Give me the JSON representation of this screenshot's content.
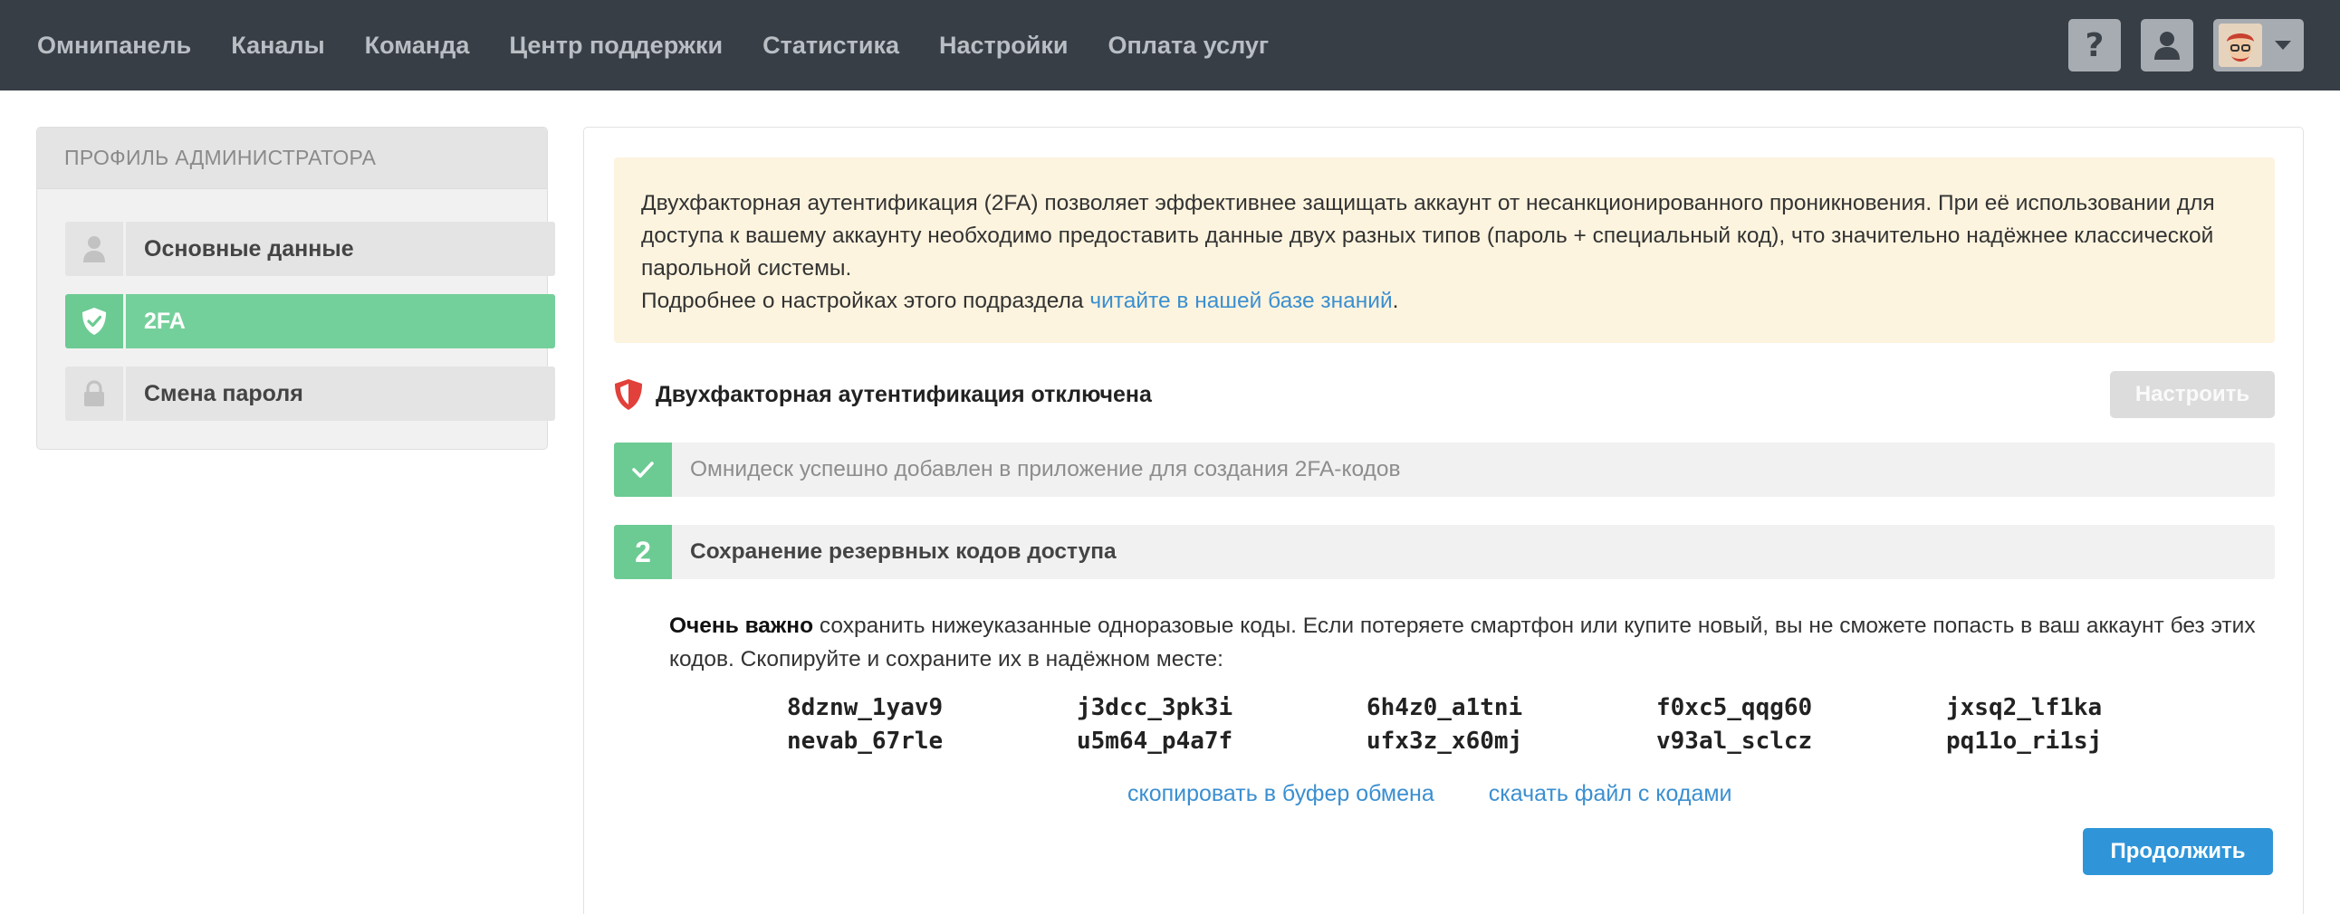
{
  "nav": {
    "items": [
      "Омнипанель",
      "Каналы",
      "Команда",
      "Центр поддержки",
      "Статистика",
      "Настройки",
      "Оплата услуг"
    ]
  },
  "topbar": {
    "help_label": "?"
  },
  "sidebar": {
    "header": "ПРОФИЛЬ АДМИНИСТРАТОРА",
    "items": [
      {
        "label": "Основные данные",
        "icon": "user-icon"
      },
      {
        "label": "2FA",
        "icon": "shield-check-icon",
        "active": true
      },
      {
        "label": "Смена пароля",
        "icon": "lock-icon"
      }
    ]
  },
  "notice": {
    "line1": "Двухфакторная аутентификация (2FA) позволяет эффективнее защищать аккаунт от несанкционированного проникновения. При её использовании для доступа к вашему аккаунту необходимо предоставить данные двух разных типов (пароль + специальный код), что значительно надёжнее классической парольной системы.",
    "line2_prefix": "Подробнее о настройках этого подраздела ",
    "link": "читайте в нашей базе знаний",
    "line2_suffix": "."
  },
  "status": {
    "text": "Двухфакторная аутентификация отключена",
    "setup_button": "Настроить"
  },
  "steps": [
    {
      "badge": "✓",
      "text": "Омнидеск успешно добавлен в приложение для создания 2FA-кодов"
    },
    {
      "badge": "2",
      "text": "Сохранение резервных кодов доступа"
    }
  ],
  "backup": {
    "bold_prefix": "Очень важно",
    "description": " сохранить нижеуказанные одноразовые коды. Если потеряете смартфон или купите новый, вы не сможете попасть в ваш аккаунт без этих кодов. Скопируйте и сохраните их в надёжном месте:",
    "codes": [
      "8dznw_1yav9",
      "j3dcc_3pk3i",
      "6h4z0_a1tni",
      "f0xc5_qqg60",
      "jxsq2_lf1ka",
      "nevab_67rle",
      "u5m64_p4a7f",
      "ufx3z_x60mj",
      "v93al_sclcz",
      "pq11o_ri1sj"
    ],
    "copy_link": "скопировать в буфер обмена",
    "download_link": "скачать файл с кодами",
    "continue_button": "Продолжить"
  },
  "colors": {
    "topbar": "#383e45",
    "accent_green": "#74d09a",
    "link_blue": "#3b8fd0",
    "primary_button": "#2f95d8",
    "notice_bg": "#fdf4df",
    "danger_red": "#e2403a"
  }
}
